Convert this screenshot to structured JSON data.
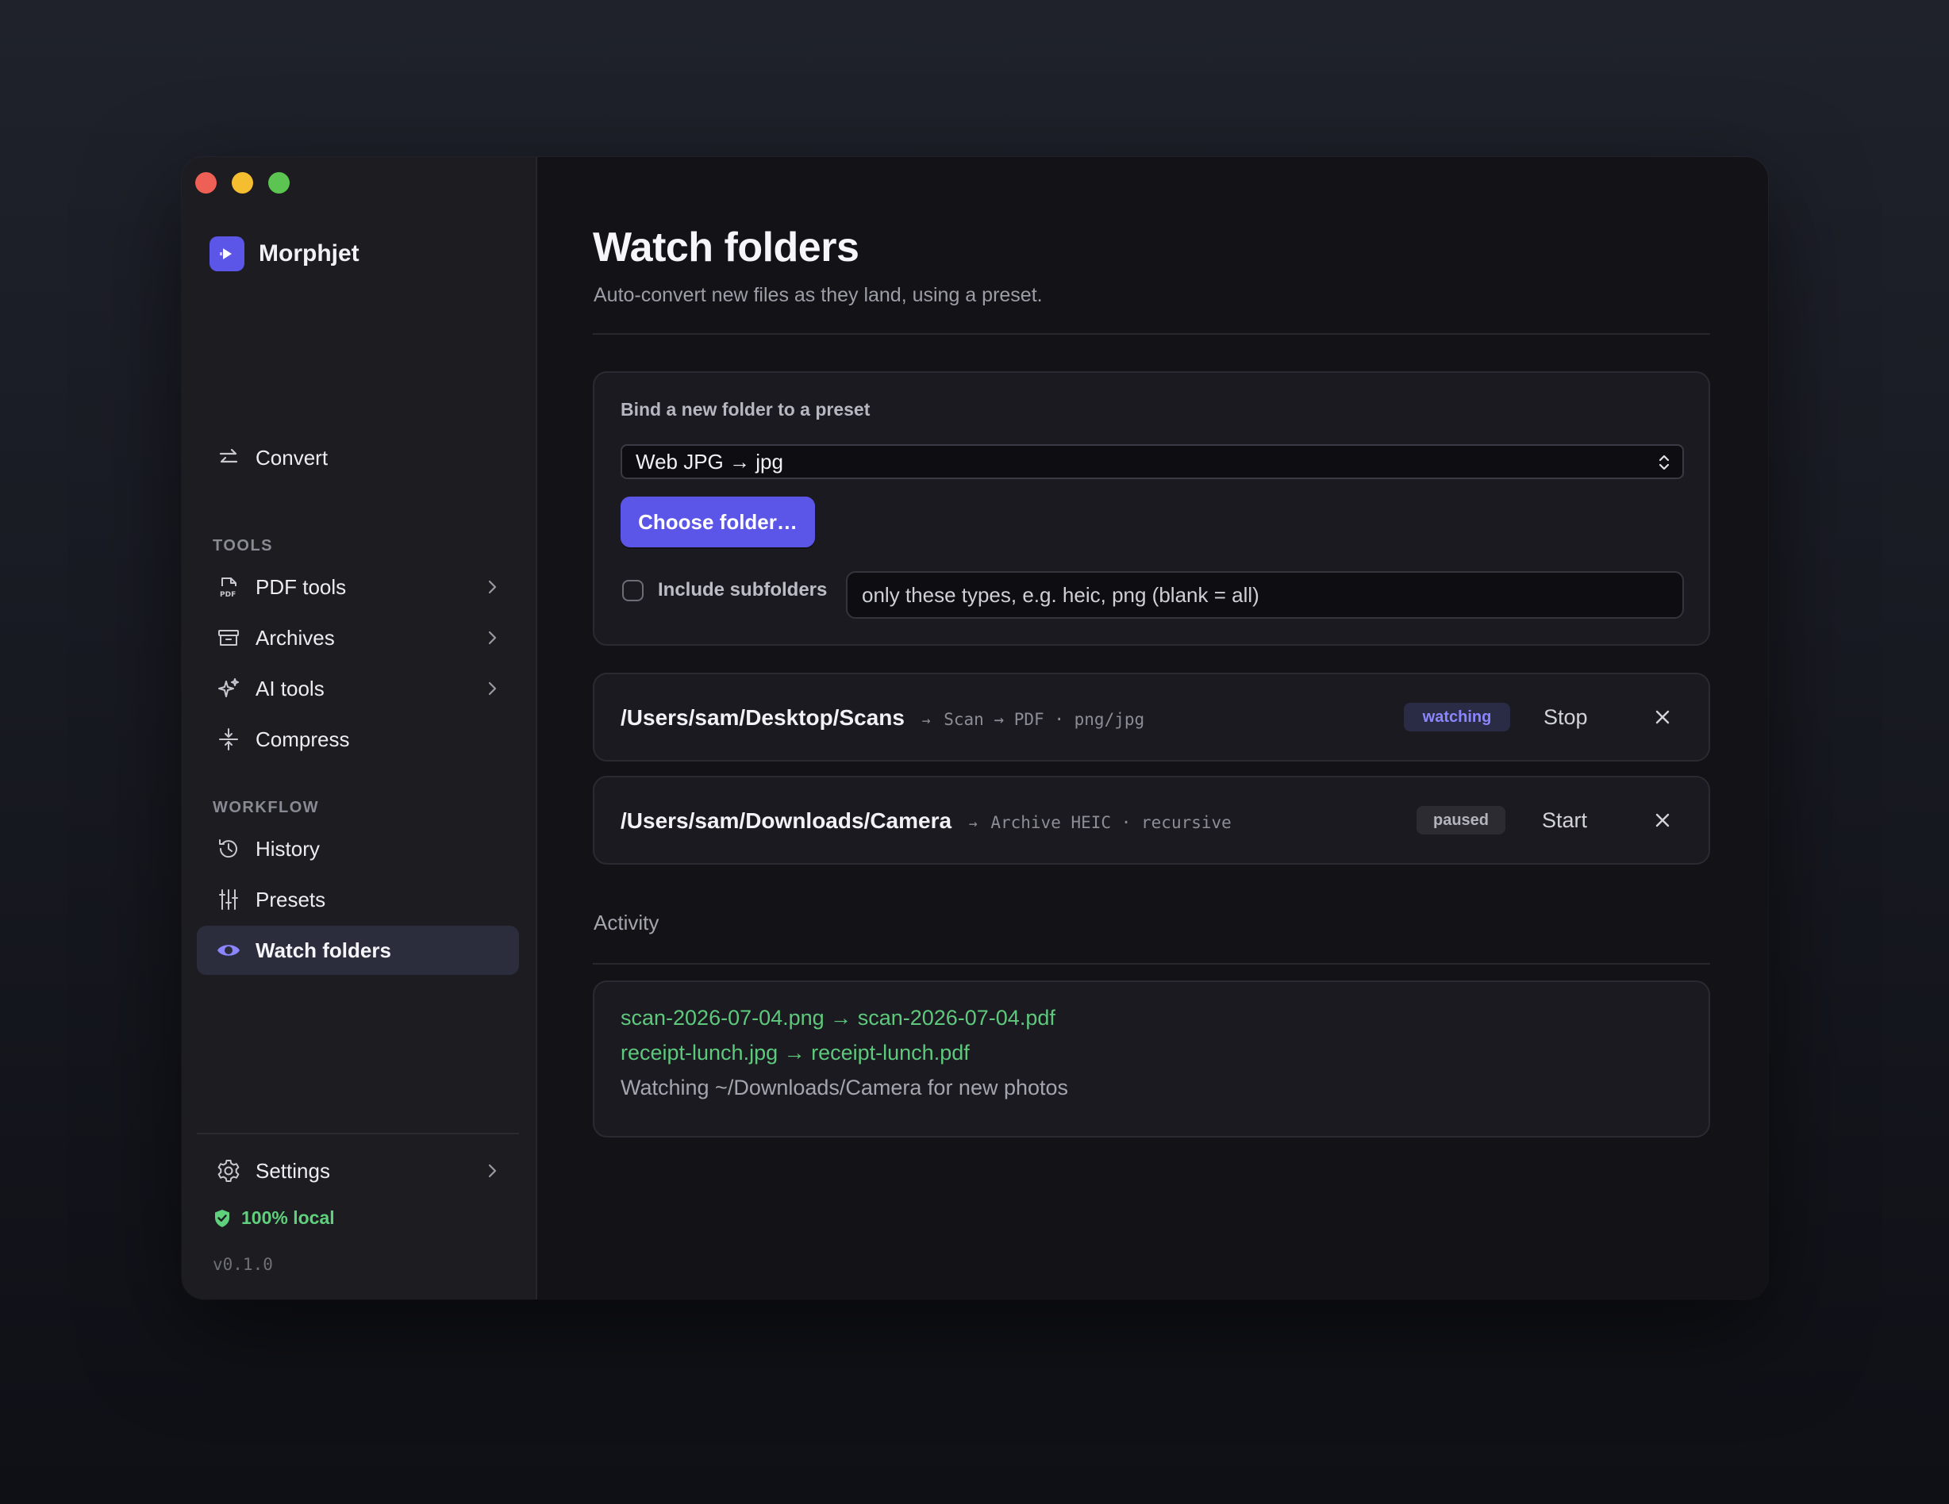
{
  "app": {
    "name": "Morphjet"
  },
  "sidebar": {
    "top_item": {
      "label": "Convert",
      "icon": "arrows-swap-icon"
    },
    "tools_label": "TOOLS",
    "tools": [
      {
        "label": "PDF tools",
        "icon": "pdf-file-icon",
        "has_submenu": true
      },
      {
        "label": "Archives",
        "icon": "archive-box-icon",
        "has_submenu": true
      },
      {
        "label": "AI tools",
        "icon": "sparkle-icon",
        "has_submenu": true
      },
      {
        "label": "Compress",
        "icon": "compress-icon",
        "has_submenu": false
      }
    ],
    "workflow_label": "WORKFLOW",
    "workflow": [
      {
        "label": "History",
        "icon": "history-icon"
      },
      {
        "label": "Presets",
        "icon": "sliders-icon"
      },
      {
        "label": "Watch folders",
        "icon": "eye-icon",
        "active": true
      }
    ],
    "settings_label": "Settings",
    "local_label": "100% local",
    "version": "v0.1.0"
  },
  "main": {
    "title": "Watch folders",
    "subtitle": "Auto-convert new files as they land, using a preset.",
    "bind": {
      "title": "Bind a new folder to a preset",
      "preset_value": "Web JPG → jpg",
      "choose_button": "Choose folder…",
      "include_subfolders_label": "Include subfolders",
      "include_subfolders_checked": false,
      "types_placeholder": "only these types, e.g. heic, png (blank = all)"
    },
    "watches": [
      {
        "path": "/Users/sam/Desktop/Scans",
        "preset": "Scan → PDF",
        "extra": "png/jpg",
        "status": "watching",
        "action": "Stop"
      },
      {
        "path": "/Users/sam/Downloads/Camera",
        "preset": "Archive HEIC",
        "extra": "recursive",
        "status": "paused",
        "action": "Start"
      }
    ],
    "activity_label": "Activity",
    "activity": [
      {
        "text": "scan-2026-07-04.png → scan-2026-07-04.pdf",
        "kind": "ok"
      },
      {
        "text": "receipt-lunch.jpg → receipt-lunch.pdf",
        "kind": "ok"
      },
      {
        "text": "Watching ~/Downloads/Camera for new photos",
        "kind": "info"
      }
    ]
  },
  "colors": {
    "accent": "#5b55e8",
    "accent_text": "#8b86ff",
    "success": "#5ec97d",
    "close_red": "#ee5f56",
    "minimize_yellow": "#f5bd30",
    "zoom_green": "#5cc451"
  }
}
